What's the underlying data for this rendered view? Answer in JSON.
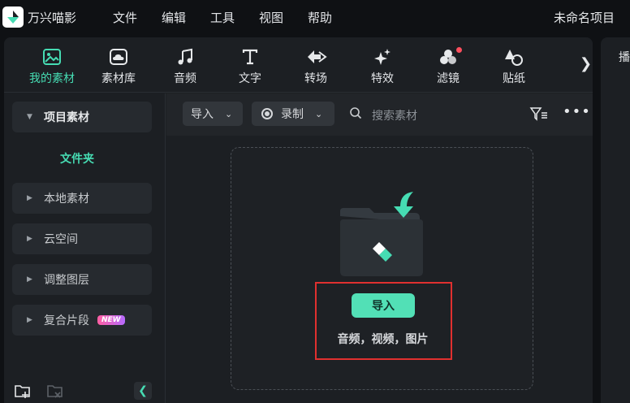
{
  "app": {
    "name": "万兴喵影",
    "project_title": "未命名项目"
  },
  "menu": [
    "文件",
    "编辑",
    "工具",
    "视图",
    "帮助"
  ],
  "toolbar": {
    "tools": [
      {
        "label": "我的素材",
        "icon": "my-media-icon",
        "active": true
      },
      {
        "label": "素材库",
        "icon": "cloud-library-icon"
      },
      {
        "label": "音频",
        "icon": "music-note-icon"
      },
      {
        "label": "文字",
        "icon": "text-t-icon"
      },
      {
        "label": "转场",
        "icon": "transition-arrows-icon"
      },
      {
        "label": "特效",
        "icon": "sparkle-star-icon"
      },
      {
        "label": "滤镜",
        "icon": "filter-circles-icon",
        "notification_dot": true
      },
      {
        "label": "贴纸",
        "icon": "sticker-icon"
      }
    ],
    "more_icon": "chevron-right-icon"
  },
  "sidebar": {
    "items": [
      {
        "label": "项目素材",
        "expanded": true
      },
      {
        "label": "本地素材"
      },
      {
        "label": "云空间"
      },
      {
        "label": "调整图层"
      },
      {
        "label": "复合片段",
        "badge": "NEW"
      }
    ],
    "folder_label": "文件夹"
  },
  "filterbar": {
    "import_dropdown": "导入",
    "record_dropdown": "录制",
    "search_placeholder": "搜索素材"
  },
  "dropzone": {
    "import_button": "导入",
    "hint": "音频，视频，图片"
  },
  "right_panel": {
    "tab_label": "播"
  },
  "colors": {
    "accent": "#46dcb3",
    "highlight_box": "#e0302f",
    "notification": "#ff4f5e"
  }
}
